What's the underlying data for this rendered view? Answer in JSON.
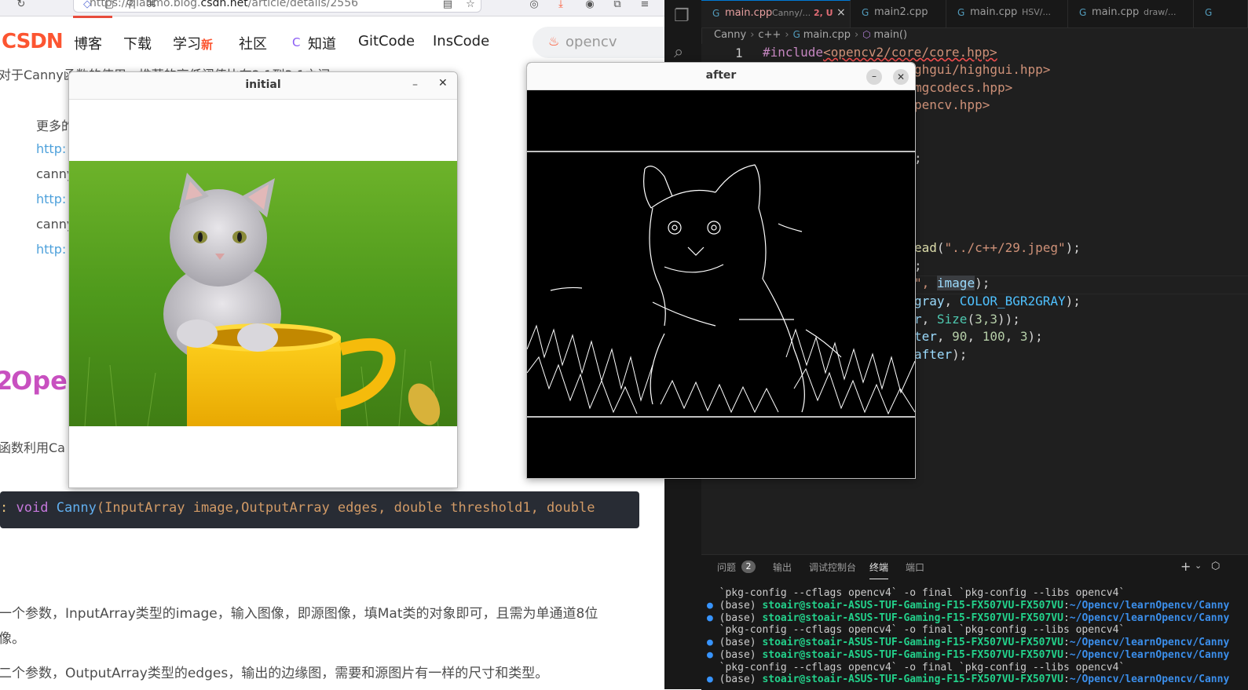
{
  "browser": {
    "url_prefix": "https://qianmo.blog.",
    "url_domain": "csdn.net",
    "url_suffix": "/article/details/2556"
  },
  "csdn": {
    "logo": "CSDN",
    "nav": [
      "博客",
      "下载",
      "学习",
      "社区",
      "知道",
      "GitCode",
      "InsCode"
    ],
    "nav_new_badge": "新",
    "search_placeholder": "opencv"
  },
  "article": {
    "para_top": "对于Canny函数的使用，推荐的高低阈值比在2:1到3:1之间。",
    "more_prefix": "更多的",
    "link1": "http:",
    "canny1": "canny",
    "link2": "http:",
    "canny2": "canny",
    "link3": "http:",
    "section_num": "2",
    "section_title": "Open",
    "para_func": "函数利用Ca",
    "code_prefix": ":",
    "code_kw": "void",
    "code_fn": "Canny",
    "code_args": "(InputArray image,OutputArray edges, double threshold1, double",
    "param1_a": "一个参数，InputArray类型的image，输入图像，即源图像，填Mat类的对象即可，且需为单通道8位",
    "param1_b": "像。",
    "param2": "二个参数，OutputArray类型的edges，输出的边缘图，需要和源图片有一样的尺寸和类型。"
  },
  "window_initial": {
    "title": "initial"
  },
  "window_after": {
    "title": "after"
  },
  "vscode": {
    "tabs": [
      {
        "label": "main.cpp",
        "desc": "Canny/...",
        "badge": "2, U"
      },
      {
        "label": "main2.cpp",
        "desc": ""
      },
      {
        "label": "main.cpp",
        "desc": "HSV/..."
      },
      {
        "label": "main.cpp",
        "desc": "draw/..."
      }
    ],
    "breadcrumb": [
      "Canny",
      "c++",
      "main.cpp",
      "main()"
    ],
    "line_number": "1",
    "code": {
      "l1_a": "#include",
      "l1_b": "<opencv2/core/core.hpp>",
      "l2": "ghgui/highgui.hpp>",
      "l3": "mgcodecs.hpp>",
      "l4": "pencv.hpp>",
      "l5": ";",
      "l6_fn": "ead",
      "l6_str": "\"../c++/29.jpeg\"",
      "l6_end": ");",
      "l7": ";",
      "l8_a": "\", ",
      "l8_var": "image",
      "l8_end": ");",
      "l9_var": "gray",
      "l9_cst": "COLOR_BGR2GRAY",
      "l10_var": "r",
      "l10_ty": "Size",
      "l10_num": "3,3",
      "l11_var": "ter",
      "l11_n1": "90",
      "l11_n2": "100",
      "l11_n3": "3",
      "l12_var": "after"
    },
    "panel": {
      "tabs": [
        "问题",
        "输出",
        "调试控制台",
        "终端",
        "端口"
      ],
      "problems_count": "2",
      "cmd": "`pkg-config --cflags opencv4` -o final `pkg-config --libs opencv4`",
      "base": "(base)",
      "host": "stoair@stoair-ASUS-TUF-Gaming-F15-FX507VU-FX507VU",
      "path": "~/Opencv/learnOpencv/Canny"
    }
  }
}
